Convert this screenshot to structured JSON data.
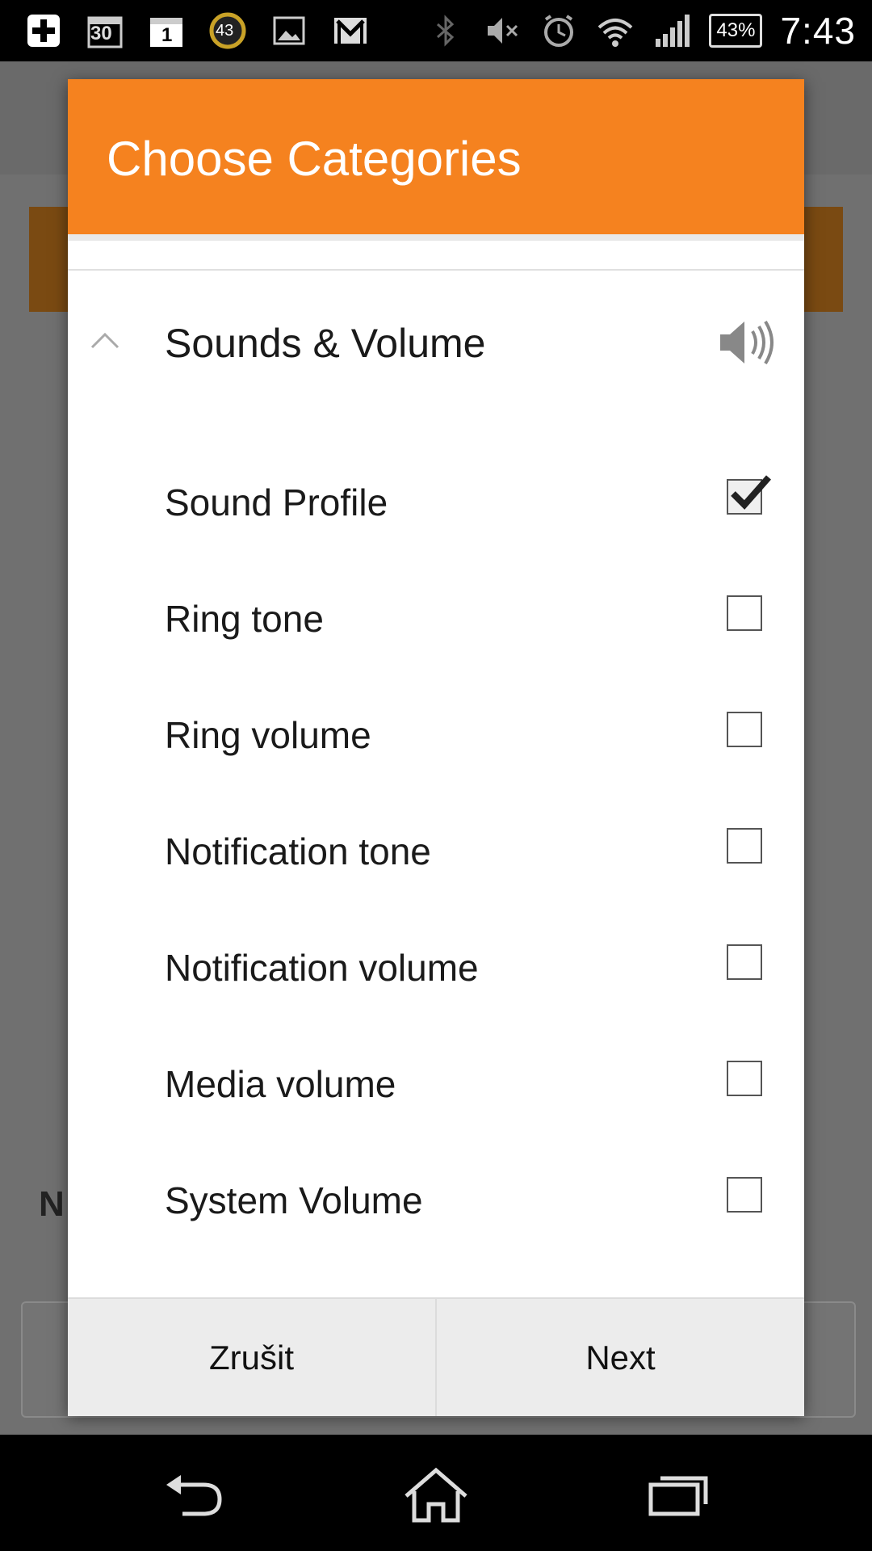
{
  "status_bar": {
    "calendar_day_a": "30",
    "calendar_day_b": "1",
    "circle_badge": "43",
    "battery": "43%",
    "time": "7:43",
    "icons": [
      "add-box-icon",
      "calendar-icon",
      "calendar-icon",
      "progress-badge-icon",
      "image-icon",
      "gmail-icon",
      "bluetooth-icon",
      "mute-icon",
      "alarm-icon",
      "wifi-icon",
      "signal-icon",
      "battery-icon"
    ]
  },
  "dialog": {
    "title": "Choose Categories",
    "group": {
      "label": "Sounds & Volume",
      "expanded": true,
      "icon": "speaker-icon"
    },
    "items": [
      {
        "label": "Sound Profile",
        "checked": true
      },
      {
        "label": "Ring tone",
        "checked": false
      },
      {
        "label": "Ring volume",
        "checked": false
      },
      {
        "label": "Notification tone",
        "checked": false
      },
      {
        "label": "Notification volume",
        "checked": false
      },
      {
        "label": "Media volume",
        "checked": false
      },
      {
        "label": "System Volume",
        "checked": false
      }
    ],
    "buttons": {
      "cancel": "Zrušit",
      "next": "Next"
    }
  },
  "background": {
    "partial_text": "N"
  },
  "colors": {
    "header": "#f5821f",
    "status_bar": "#000000",
    "footer": "#ececec"
  }
}
